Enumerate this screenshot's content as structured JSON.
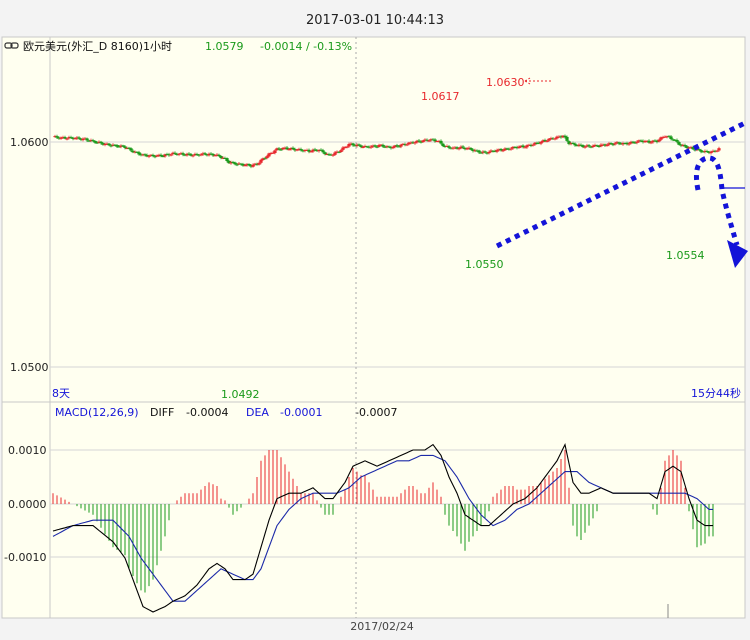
{
  "window": {
    "datetime": "2017-03-01 10:44:13"
  },
  "header": {
    "icon": "chain-link-icon",
    "symbol": "欧元美元(外汇_D 8160)1小时",
    "last_price": "1.0579",
    "change": "-0.0014 / -0.13%"
  },
  "colors": {
    "background": "#fffff0",
    "frame": "#f3f3f3",
    "up": "#e8282d",
    "down": "#1a9a1a",
    "annotation": "#1414d8",
    "macd_line": "#000000",
    "signal_line": "#1c2aa8"
  },
  "price_panel": {
    "y_ticks": [
      "1.0600",
      "1.0500"
    ],
    "period_label": "8天",
    "countdown": "15分44秒",
    "annotations": {
      "high_a": "1.0617",
      "high_b": "1.0630",
      "low_a": "1.0492",
      "low_b": "1.0550",
      "low_c": "1.0554"
    }
  },
  "macd_panel": {
    "title": "MACD(12,26,9)",
    "diff_label": "DIFF",
    "diff_value": "-0.0004",
    "dea_label": "DEA",
    "dea_value": "-0.0001",
    "macd_value": "-0.0007",
    "y_ticks": [
      "0.0010",
      "0.0000",
      "-0.0010"
    ]
  },
  "x_axis": {
    "date_label": "2017/02/24"
  },
  "chart_data": [
    {
      "type": "candlestick",
      "title": "欧元美元(外汇_D 8160)1小时",
      "ylim": [
        1.0485,
        1.064
      ],
      "y_ticks": [
        1.06,
        1.05
      ],
      "grid": true,
      "series": [
        {
          "name": "price",
          "anchors": [
            [
              0,
              1.0623
            ],
            [
              4,
              1.0618
            ],
            [
              10,
              1.0618
            ],
            [
              16,
              1.0612
            ],
            [
              20,
              1.0603
            ],
            [
              26,
              1.059
            ],
            [
              30,
              1.0585
            ],
            [
              36,
              1.0578
            ],
            [
              40,
              1.0558
            ],
            [
              45,
              1.0541
            ],
            [
              50,
              1.0538
            ],
            [
              55,
              1.054
            ],
            [
              60,
              1.0548
            ],
            [
              66,
              1.0545
            ],
            [
              70,
              1.0542
            ],
            [
              76,
              1.0546
            ],
            [
              81,
              1.0543
            ],
            [
              85,
              1.053
            ],
            [
              88,
              1.051
            ],
            [
              92,
              1.0502
            ],
            [
              96,
              1.0498
            ],
            [
              99,
              1.0495
            ],
            [
              102,
              1.0502
            ],
            [
              105,
              1.0525
            ],
            [
              108,
              1.0545
            ],
            [
              112,
              1.0568
            ],
            [
              116,
              1.0572
            ],
            [
              122,
              1.0566
            ],
            [
              128,
              1.056
            ],
            [
              133,
              1.0565
            ],
            [
              138,
              1.054
            ],
            [
              141,
              1.055
            ],
            [
              144,
              1.0565
            ],
            [
              148,
              1.059
            ],
            [
              152,
              1.0585
            ],
            [
              156,
              1.0578
            ],
            [
              160,
              1.058
            ],
            [
              164,
              1.0585
            ],
            [
              168,
              1.0575
            ],
            [
              172,
              1.0582
            ],
            [
              176,
              1.059
            ],
            [
              180,
              1.0598
            ],
            [
              184,
              1.0604
            ],
            [
              188,
              1.061
            ],
            [
              192,
              1.0606
            ],
            [
              196,
              1.058
            ],
            [
              200,
              1.0572
            ],
            [
              204,
              1.0575
            ],
            [
              208,
              1.057
            ],
            [
              212,
              1.0558
            ],
            [
              216,
              1.0552
            ],
            [
              220,
              1.056
            ],
            [
              224,
              1.0565
            ],
            [
              228,
              1.057
            ],
            [
              232,
              1.0578
            ],
            [
              236,
              1.058
            ],
            [
              240,
              1.059
            ],
            [
              244,
              1.06
            ],
            [
              248,
              1.0612
            ],
            [
              252,
              1.062
            ],
            [
              255,
              1.0628
            ],
            [
              258,
              1.0595
            ],
            [
              262,
              1.0586
            ],
            [
              266,
              1.058
            ],
            [
              270,
              1.0582
            ],
            [
              274,
              1.0585
            ],
            [
              278,
              1.059
            ],
            [
              282,
              1.0595
            ],
            [
              286,
              1.0592
            ],
            [
              290,
              1.0598
            ],
            [
              294,
              1.0605
            ],
            [
              298,
              1.06
            ],
            [
              302,
              1.0605
            ],
            [
              306,
              1.0628
            ],
            [
              310,
              1.0612
            ],
            [
              314,
              1.0585
            ],
            [
              318,
              1.0575
            ],
            [
              322,
              1.0565
            ],
            [
              326,
              1.0556
            ],
            [
              330,
              1.0556
            ],
            [
              333,
              1.057
            ]
          ]
        }
      ]
    },
    {
      "type": "line+bar",
      "title": "MACD(12,26,9)",
      "ylim": [
        -0.0021,
        0.0017
      ],
      "y_ticks": [
        0.001,
        0.0,
        -0.001
      ],
      "grid": true,
      "series": [
        {
          "name": "DIFF",
          "anchors": [
            [
              0,
              -0.0005
            ],
            [
              10,
              -0.0004
            ],
            [
              20,
              -0.0004
            ],
            [
              30,
              -0.0007
            ],
            [
              36,
              -0.001
            ],
            [
              40,
              -0.0014
            ],
            [
              45,
              -0.0019
            ],
            [
              50,
              -0.002
            ],
            [
              56,
              -0.0019
            ],
            [
              60,
              -0.0018
            ],
            [
              66,
              -0.0017
            ],
            [
              72,
              -0.0015
            ],
            [
              78,
              -0.0012
            ],
            [
              82,
              -0.0011
            ],
            [
              86,
              -0.0012
            ],
            [
              90,
              -0.0014
            ],
            [
              96,
              -0.0014
            ],
            [
              100,
              -0.0013
            ],
            [
              104,
              -0.0008
            ],
            [
              108,
              -0.0003
            ],
            [
              112,
              0.0001
            ],
            [
              118,
              0.0002
            ],
            [
              124,
              0.0002
            ],
            [
              130,
              0.0003
            ],
            [
              136,
              0.0001
            ],
            [
              140,
              0.0001
            ],
            [
              146,
              0.0004
            ],
            [
              150,
              0.0007
            ],
            [
              156,
              0.0008
            ],
            [
              162,
              0.0007
            ],
            [
              168,
              0.0008
            ],
            [
              174,
              0.0009
            ],
            [
              180,
              0.001
            ],
            [
              186,
              0.001
            ],
            [
              190,
              0.0011
            ],
            [
              194,
              0.0009
            ],
            [
              198,
              0.0005
            ],
            [
              202,
              0.0002
            ],
            [
              206,
              -0.0002
            ],
            [
              210,
              -0.0003
            ],
            [
              214,
              -0.0004
            ],
            [
              218,
              -0.0004
            ],
            [
              224,
              -0.0002
            ],
            [
              230,
              0.0
            ],
            [
              236,
              0.0001
            ],
            [
              242,
              0.0003
            ],
            [
              248,
              0.0006
            ],
            [
              252,
              0.0008
            ],
            [
              256,
              0.0011
            ],
            [
              260,
              0.0004
            ],
            [
              264,
              0.0002
            ],
            [
              268,
              0.0002
            ],
            [
              274,
              0.0003
            ],
            [
              280,
              0.0002
            ],
            [
              286,
              0.0002
            ],
            [
              292,
              0.0002
            ],
            [
              298,
              0.0002
            ],
            [
              302,
              0.0001
            ],
            [
              306,
              0.0006
            ],
            [
              310,
              0.0007
            ],
            [
              314,
              0.0006
            ],
            [
              318,
              0.0001
            ],
            [
              322,
              -0.0003
            ],
            [
              326,
              -0.0004
            ],
            [
              330,
              -0.0004
            ]
          ]
        },
        {
          "name": "DEA",
          "anchors": [
            [
              0,
              -0.0006
            ],
            [
              10,
              -0.0004
            ],
            [
              20,
              -0.0003
            ],
            [
              30,
              -0.0003
            ],
            [
              38,
              -0.0006
            ],
            [
              44,
              -0.001
            ],
            [
              50,
              -0.0013
            ],
            [
              56,
              -0.0016
            ],
            [
              60,
              -0.0018
            ],
            [
              66,
              -0.0018
            ],
            [
              72,
              -0.0016
            ],
            [
              78,
              -0.0014
            ],
            [
              84,
              -0.0012
            ],
            [
              90,
              -0.0013
            ],
            [
              96,
              -0.0014
            ],
            [
              100,
              -0.0014
            ],
            [
              104,
              -0.0012
            ],
            [
              108,
              -0.0008
            ],
            [
              112,
              -0.0004
            ],
            [
              118,
              -0.0001
            ],
            [
              124,
              0.0001
            ],
            [
              130,
              0.0002
            ],
            [
              136,
              0.0002
            ],
            [
              142,
              0.0002
            ],
            [
              148,
              0.0003
            ],
            [
              154,
              0.0005
            ],
            [
              160,
              0.0006
            ],
            [
              166,
              0.0007
            ],
            [
              172,
              0.0008
            ],
            [
              178,
              0.0008
            ],
            [
              184,
              0.0009
            ],
            [
              190,
              0.0009
            ],
            [
              196,
              0.0008
            ],
            [
              202,
              0.0005
            ],
            [
              208,
              0.0001
            ],
            [
              214,
              -0.0002
            ],
            [
              220,
              -0.0004
            ],
            [
              226,
              -0.0003
            ],
            [
              232,
              -0.0001
            ],
            [
              238,
              0.0
            ],
            [
              244,
              0.0002
            ],
            [
              250,
              0.0004
            ],
            [
              256,
              0.0006
            ],
            [
              262,
              0.0006
            ],
            [
              268,
              0.0004
            ],
            [
              274,
              0.0003
            ],
            [
              280,
              0.0002
            ],
            [
              286,
              0.0002
            ],
            [
              292,
              0.0002
            ],
            [
              298,
              0.0002
            ],
            [
              304,
              0.0002
            ],
            [
              310,
              0.0002
            ],
            [
              316,
              0.0002
            ],
            [
              322,
              0.0001
            ],
            [
              328,
              -0.0001
            ],
            [
              330,
              -0.0001
            ]
          ]
        }
      ]
    }
  ]
}
